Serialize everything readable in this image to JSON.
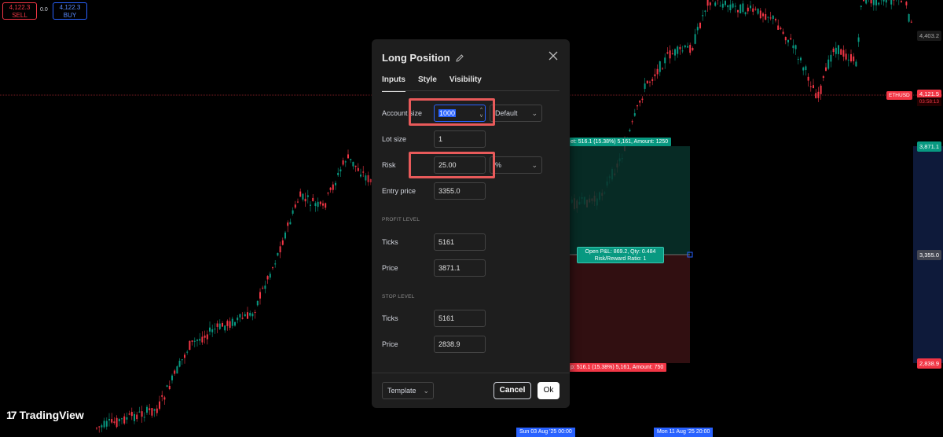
{
  "trade_buttons": {
    "sell_price": "4,122.3",
    "sell_label": "SELL",
    "spread": "0.0",
    "buy_price": "4,122.3",
    "buy_label": "BUY"
  },
  "price_axis": {
    "top_price": "4,403.2",
    "current_price": "4,121.5",
    "countdown": "03:58:13",
    "symbol": "ETHUSD",
    "target_price": "3,871.1",
    "entry_price": "3,355.0",
    "stop_price": "2,838.9"
  },
  "position_tool": {
    "target_label": "et: 516.1 (15.38%) 5,161, Amount: 1250",
    "stop_label": "p: 516.1 (15.38%) 5,161, Amount: 750",
    "pnl_line1": "Open P&L: 869.2, Qty: 0.484",
    "pnl_line2": "Risk/Reward Ratio: 1"
  },
  "time_axis": {
    "start": "Sun 03 Aug '25   00:00",
    "end": "Mon 11 Aug '25   20:00"
  },
  "logo": {
    "text": "TradingView",
    "mark": "17"
  },
  "dialog": {
    "title": "Long Position",
    "tabs": [
      {
        "label": "Inputs"
      },
      {
        "label": "Style"
      },
      {
        "label": "Visibility"
      }
    ],
    "account_size": {
      "label": "Account size",
      "value": "1000",
      "currency": "Default"
    },
    "lot_size": {
      "label": "Lot size",
      "value": "1"
    },
    "risk": {
      "label": "Risk",
      "value": "25.00",
      "unit": "%"
    },
    "entry_price": {
      "label": "Entry price",
      "value": "3355.0"
    },
    "profit_level": {
      "section": "PROFIT LEVEL",
      "ticks_label": "Ticks",
      "ticks": "5161",
      "price_label": "Price",
      "price": "3871.1"
    },
    "stop_level": {
      "section": "STOP LEVEL",
      "ticks_label": "Ticks",
      "ticks": "5161",
      "price_label": "Price",
      "price": "2838.9"
    },
    "template_label": "Template",
    "cancel_label": "Cancel",
    "ok_label": "Ok"
  },
  "colors": {
    "up": "#089981",
    "down": "#f23645",
    "accent": "#2962ff",
    "highlight": "#e85a5a"
  }
}
